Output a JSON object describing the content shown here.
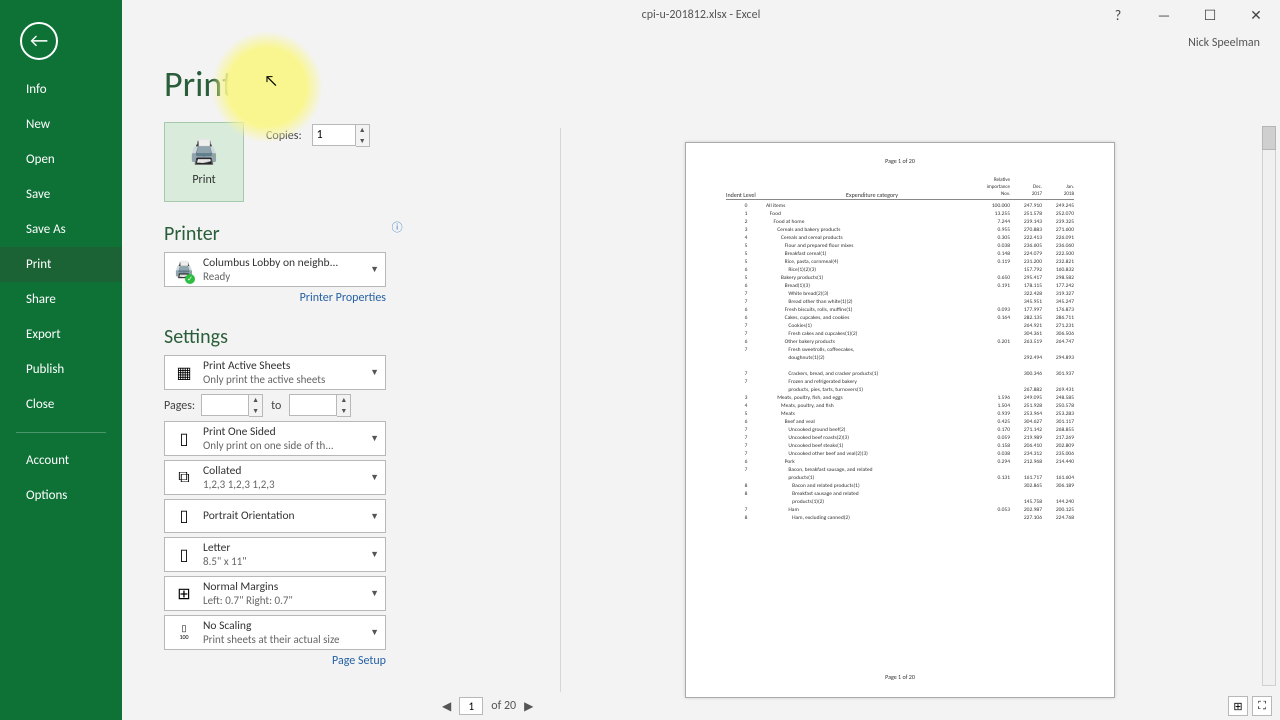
{
  "title_bar": {
    "center": "cpi-u-201812.xlsx - Excel",
    "help": "?",
    "user": "Nick Speelman"
  },
  "sidebar": {
    "items": [
      "Info",
      "New",
      "Open",
      "Save",
      "Save As",
      "Print",
      "Share",
      "Export",
      "Publish",
      "Close"
    ],
    "lower": [
      "Account",
      "Options"
    ],
    "active_index": 5
  },
  "page": {
    "title": "Print",
    "print_btn": "Print",
    "copies_label": "Copies:",
    "copies_value": "1",
    "printer_section": "Printer",
    "printer_name": "Columbus Lobby on neighb...",
    "printer_status": "Ready",
    "printer_properties": "Printer Properties",
    "settings_section": "Settings",
    "pages_label": "Pages:",
    "pages_to": "to",
    "page_setup": "Page Setup",
    "opt_active_sheets": {
      "l1": "Print Active Sheets",
      "l2": "Only print the active sheets"
    },
    "opt_one_sided": {
      "l1": "Print One Sided",
      "l2": "Only print on one side of th..."
    },
    "opt_collated": {
      "l1": "Collated",
      "l2": "1,2,3    1,2,3    1,2,3"
    },
    "opt_orientation": {
      "l1": "Portrait Orientation",
      "l2": ""
    },
    "opt_letter": {
      "l1": "Letter",
      "l2": "8.5\" x 11\""
    },
    "opt_margins": {
      "l1": "Normal Margins",
      "l2": "Left:  0.7\"    Right:  0.7\""
    },
    "opt_scaling": {
      "l1": "No Scaling",
      "l2": "Print sheets at their actual size"
    }
  },
  "footer": {
    "prev": "◀",
    "next": "▶",
    "page": "1",
    "of": "of 20"
  },
  "preview": {
    "page_label": "Page 1 of 20",
    "headers": {
      "indent": "Indent Level",
      "expenditure": "Expenditure category",
      "cols_top": [
        "Relative",
        "",
        ""
      ],
      "cols_mid": [
        "importance",
        "Dec.",
        "Jan."
      ],
      "cols_bot": [
        "Nov.",
        "2017",
        "2018"
      ]
    },
    "rows": [
      {
        "ind": "0",
        "pad": 0,
        "exp": "All items",
        "v": [
          "100.000",
          "247.910",
          "249.245"
        ]
      },
      {
        "ind": "1",
        "pad": 1,
        "exp": "Food",
        "v": [
          "13.255",
          "251.578",
          "252.070"
        ]
      },
      {
        "ind": "2",
        "pad": 2,
        "exp": "Food at home",
        "v": [
          "7.244",
          "239.143",
          "239.325"
        ]
      },
      {
        "ind": "3",
        "pad": 3,
        "exp": "Cereals and bakery products",
        "v": [
          "0.955",
          "270.883",
          "271.600"
        ]
      },
      {
        "ind": "4",
        "pad": 4,
        "exp": "Cereals and cereal products",
        "v": [
          "0.305",
          "222.413",
          "226.091"
        ]
      },
      {
        "ind": "5",
        "pad": 5,
        "exp": "Flour and prepared flour mixes",
        "v": [
          "0.038",
          "236.605",
          "236.060"
        ]
      },
      {
        "ind": "5",
        "pad": 5,
        "exp": "Breakfast cereal(1)",
        "v": [
          "0.148",
          "224.079",
          "222.500"
        ]
      },
      {
        "ind": "5",
        "pad": 5,
        "exp": "Rice, pasta, cornmeal(4)",
        "v": [
          "0.119",
          "231.200",
          "232.821"
        ]
      },
      {
        "ind": "6",
        "pad": 6,
        "exp": "Rice(1)(2)(3)",
        "v": [
          "",
          "157.792",
          "160.832"
        ]
      },
      {
        "ind": "5",
        "pad": 4,
        "exp": "Bakery products(1)",
        "v": [
          "0.650",
          "295.417",
          "298.582"
        ]
      },
      {
        "ind": "6",
        "pad": 5,
        "exp": "Bread(1)(3)",
        "v": [
          "0.191",
          "178.115",
          "177.242"
        ]
      },
      {
        "ind": "7",
        "pad": 6,
        "exp": "White bread(2)(3)",
        "v": [
          "",
          "322.428",
          "319.327"
        ]
      },
      {
        "ind": "7",
        "pad": 6,
        "exp": "Bread other than white(1)(2)",
        "v": [
          "",
          "345.951",
          "345.247"
        ]
      },
      {
        "ind": "6",
        "pad": 5,
        "exp": "Fresh biscuits, rolls, muffins(1)",
        "v": [
          "0.093",
          "177.997",
          "176.873"
        ]
      },
      {
        "ind": "6",
        "pad": 5,
        "exp": "Cakes, cupcakes, and cookies",
        "v": [
          "0.164",
          "282.135",
          "286.711"
        ]
      },
      {
        "ind": "7",
        "pad": 6,
        "exp": "Cookies(1)",
        "v": [
          "",
          "264.921",
          "271.231"
        ]
      },
      {
        "ind": "7",
        "pad": 6,
        "exp": "Fresh cakes and cupcakes(1)(2)",
        "v": [
          "",
          "304.361",
          "306.506"
        ]
      },
      {
        "ind": "6",
        "pad": 5,
        "exp": "Other bakery products",
        "v": [
          "0.201",
          "263.519",
          "264.747"
        ]
      },
      {
        "ind": "7",
        "pad": 6,
        "exp": "Fresh sweetrolls, coffeecakes,",
        "v": [
          "",
          "",
          ""
        ]
      },
      {
        "ind": "",
        "pad": 6,
        "exp": "doughnuts(1)(2)",
        "v": [
          "",
          "292.494",
          "294.893"
        ]
      },
      {
        "ind": "",
        "pad": 0,
        "exp": " ",
        "v": [
          "",
          "",
          ""
        ]
      },
      {
        "ind": "7",
        "pad": 6,
        "exp": "Crackers, bread, and cracker products(1)",
        "v": [
          "",
          "300.346",
          "301.937"
        ]
      },
      {
        "ind": "7",
        "pad": 6,
        "exp": "Frozen and refrigerated bakery",
        "v": [
          "",
          "",
          ""
        ]
      },
      {
        "ind": "",
        "pad": 6,
        "exp": "products, pies, tarts, turnovers(1)",
        "v": [
          "",
          "267.882",
          "269.431"
        ]
      },
      {
        "ind": "3",
        "pad": 3,
        "exp": "Meats, poultry, fish, and eggs",
        "v": [
          "1.596",
          "249.095",
          "248.585"
        ]
      },
      {
        "ind": "4",
        "pad": 4,
        "exp": "Meats, poultry, and fish",
        "v": [
          "1.504",
          "251.928",
          "250.578"
        ]
      },
      {
        "ind": "5",
        "pad": 4,
        "exp": "Meats",
        "v": [
          "0.939",
          "253.964",
          "253.283"
        ]
      },
      {
        "ind": "6",
        "pad": 5,
        "exp": "Beef and veal",
        "v": [
          "0.425",
          "304.627",
          "301.117"
        ]
      },
      {
        "ind": "7",
        "pad": 6,
        "exp": "Uncooked ground beef(2)",
        "v": [
          "0.170",
          "271.142",
          "268.855"
        ]
      },
      {
        "ind": "7",
        "pad": 6,
        "exp": "Uncooked beef roasts(2)(3)",
        "v": [
          "0.059",
          "219.989",
          "217.269"
        ]
      },
      {
        "ind": "7",
        "pad": 6,
        "exp": "Uncooked beef steaks(1)",
        "v": [
          "0.158",
          "206.410",
          "202.809"
        ]
      },
      {
        "ind": "7",
        "pad": 6,
        "exp": "Uncooked other beef and veal(2)(3)",
        "v": [
          "0.038",
          "234.312",
          "235.006"
        ]
      },
      {
        "ind": "6",
        "pad": 5,
        "exp": "Pork",
        "v": [
          "0.294",
          "212.968",
          "214.440"
        ]
      },
      {
        "ind": "7",
        "pad": 6,
        "exp": "Bacon, breakfast sausage, and related",
        "v": [
          "",
          "",
          ""
        ]
      },
      {
        "ind": "",
        "pad": 6,
        "exp": "products(1)",
        "v": [
          "0.131",
          "161.717",
          "161.604"
        ]
      },
      {
        "ind": "8",
        "pad": 7,
        "exp": "Bacon and related products(1)",
        "v": [
          "",
          "302.865",
          "306.189"
        ]
      },
      {
        "ind": "8",
        "pad": 7,
        "exp": "Breakfast sausage and related",
        "v": [
          "",
          "",
          ""
        ]
      },
      {
        "ind": "",
        "pad": 7,
        "exp": "products(1)(2)",
        "v": [
          "",
          "145.758",
          "144.240"
        ]
      },
      {
        "ind": "7",
        "pad": 6,
        "exp": "Ham",
        "v": [
          "0.053",
          "202.987",
          "200.125"
        ]
      },
      {
        "ind": "8",
        "pad": 7,
        "exp": "Ham, excluding canned(2)",
        "v": [
          "",
          "227.106",
          "224.768"
        ]
      }
    ]
  }
}
